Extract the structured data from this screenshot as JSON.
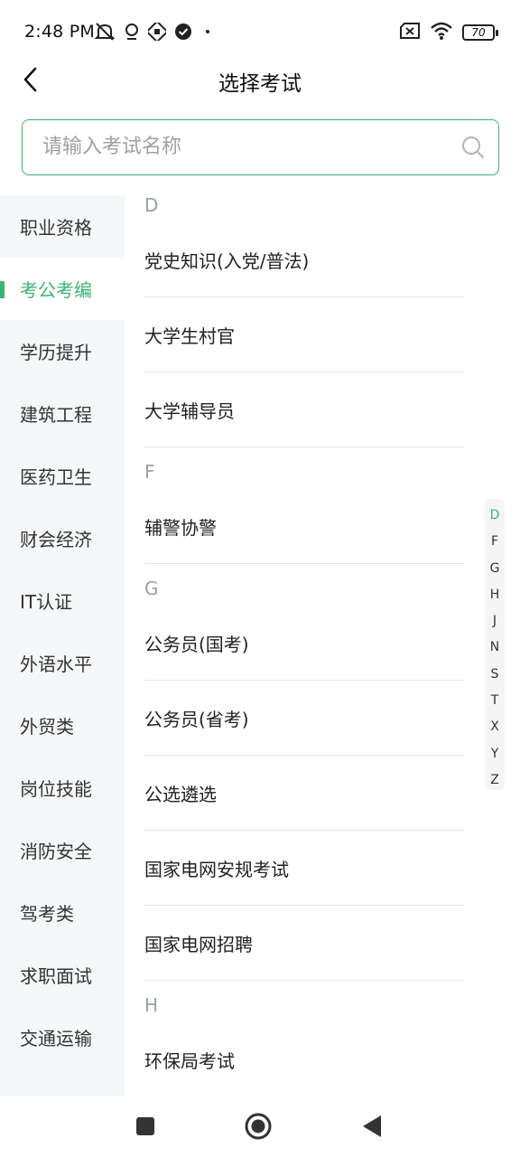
{
  "status_bar": {
    "time": "2:48 PM",
    "battery": "70",
    "icons": [
      "mute-icon",
      "location-icon",
      "app-icon",
      "check-circle-icon",
      "dot-icon",
      "sim-off-icon",
      "wifi-icon",
      "battery-icon"
    ]
  },
  "header": {
    "title": "选择考试",
    "back_icon": "chevron-left-icon"
  },
  "search": {
    "placeholder": "请输入考试名称",
    "value": ""
  },
  "sidebar": {
    "items": [
      {
        "label": "职业资格",
        "active": false
      },
      {
        "label": "考公考编",
        "active": true
      },
      {
        "label": "学历提升",
        "active": false
      },
      {
        "label": "建筑工程",
        "active": false
      },
      {
        "label": "医药卫生",
        "active": false
      },
      {
        "label": "财会经济",
        "active": false
      },
      {
        "label": "IT认证",
        "active": false
      },
      {
        "label": "外语水平",
        "active": false
      },
      {
        "label": "外贸类",
        "active": false
      },
      {
        "label": "岗位技能",
        "active": false
      },
      {
        "label": "消防安全",
        "active": false
      },
      {
        "label": "驾考类",
        "active": false
      },
      {
        "label": "求职面试",
        "active": false
      },
      {
        "label": "交通运输",
        "active": false
      }
    ]
  },
  "groups": [
    {
      "letter": "D",
      "items": [
        "党史知识(入党/普法)",
        "大学生村官",
        "大学辅导员"
      ]
    },
    {
      "letter": "F",
      "items": [
        "辅警协警"
      ]
    },
    {
      "letter": "G",
      "items": [
        "公务员(国考)",
        "公务员(省考)",
        "公选遴选",
        "国家电网安规考试",
        "国家电网招聘"
      ]
    },
    {
      "letter": "H",
      "items": [
        "环保局考试"
      ]
    }
  ],
  "index_bar": {
    "letters": [
      "D",
      "F",
      "G",
      "H",
      "J",
      "N",
      "S",
      "T",
      "X",
      "Y",
      "Z"
    ],
    "active": "D"
  },
  "colors": {
    "accent": "#3cb371",
    "sidebar_bg": "#f5f7f9",
    "section_letter": "#9aa0a6"
  }
}
